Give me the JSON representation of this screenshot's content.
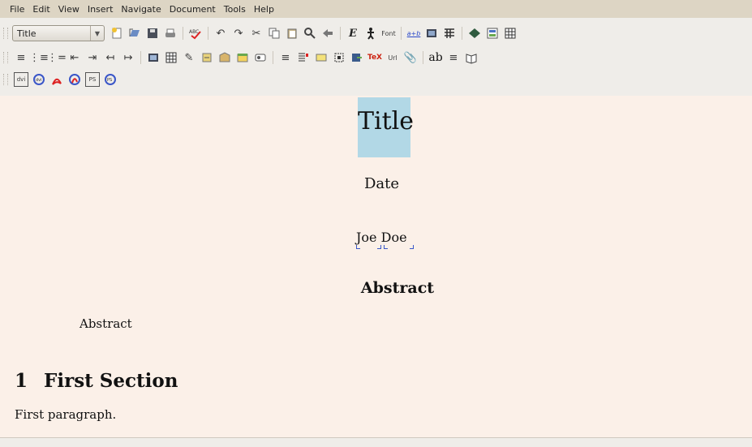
{
  "menu": [
    "File",
    "Edit",
    "View",
    "Insert",
    "Navigate",
    "Document",
    "Tools",
    "Help"
  ],
  "toolbar": {
    "paragraph_style": "Title",
    "row1_icons": [
      "new-document-icon",
      "open-icon",
      "save-icon",
      "print-icon",
      "spellcheck-icon",
      "undo-icon",
      "redo-icon",
      "cut-icon",
      "copy-icon",
      "paste-icon",
      "find-replace-icon",
      "back-icon",
      "emphasis-icon",
      "noun-icon",
      "font-icon",
      "math-icon",
      "figure-icon",
      "table-icon",
      "view-icon",
      "compare-icon",
      "grid-icon"
    ],
    "row2_icons": [
      "align-icon",
      "numbered-list-icon",
      "bullet-list-icon",
      "indent-decrease-icon",
      "indent-increase-icon",
      "depth-decrease-icon",
      "depth-increase-icon",
      "graphics-icon",
      "table-insert-icon",
      "label-icon",
      "cross-ref-icon",
      "citation-icon",
      "index-icon",
      "nomenclature-icon",
      "footnote-icon",
      "marginal-note-icon",
      "note-icon",
      "hyperlink-icon",
      "include-icon",
      "tex-icon",
      "url-icon",
      "attachment-icon",
      "ab-icon",
      "toc-icon",
      "book-icon"
    ],
    "row3_icons": [
      "dvi-icon",
      "dvi-update-icon",
      "pdf-icon",
      "pdf-update-icon",
      "ps-icon",
      "ps-update-icon"
    ],
    "labels": {
      "emphasis": "E",
      "font": "Font",
      "math": "a+b",
      "tex": "TeX",
      "url": "Url",
      "ab": "ab",
      "dvi": "dvi",
      "ps": "PS",
      "abc": "ABC"
    }
  },
  "document": {
    "title": "Title",
    "date": "Date",
    "author_first": "Joe",
    "author_last": "Doe",
    "abstract_heading": "Abstract",
    "abstract_text": "Abstract",
    "section_number": "1",
    "section_title": "First Section",
    "paragraph": "First paragraph."
  }
}
